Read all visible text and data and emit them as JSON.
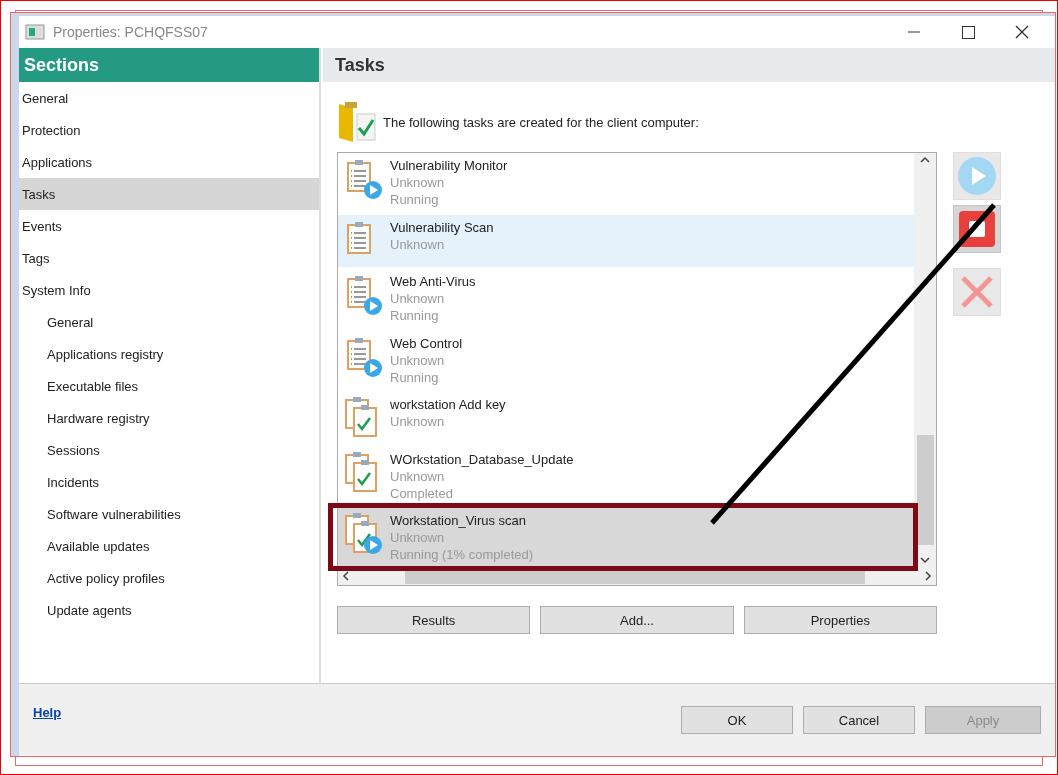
{
  "window": {
    "title": "Properties: PCHQFSS07"
  },
  "sidebar": {
    "title": "Sections",
    "items": [
      {
        "label": "General",
        "selected": false
      },
      {
        "label": "Protection",
        "selected": false
      },
      {
        "label": "Applications",
        "selected": false
      },
      {
        "label": "Tasks",
        "selected": true
      },
      {
        "label": "Events",
        "selected": false
      },
      {
        "label": "Tags",
        "selected": false
      },
      {
        "label": "System Info",
        "selected": false,
        "children": [
          {
            "label": "General",
            "selected": false
          },
          {
            "label": "Applications registry",
            "selected": false
          },
          {
            "label": "Executable files",
            "selected": false
          },
          {
            "label": "Hardware registry",
            "selected": false
          },
          {
            "label": "Sessions",
            "selected": false
          },
          {
            "label": "Incidents",
            "selected": false
          },
          {
            "label": "Software vulnerabilities",
            "selected": false
          },
          {
            "label": "Available updates",
            "selected": false
          },
          {
            "label": "Active policy profiles",
            "selected": false
          },
          {
            "label": "Update agents",
            "selected": false
          }
        ]
      }
    ]
  },
  "pane": {
    "title": "Tasks",
    "intro": "The following tasks are created for the client computer:"
  },
  "tasks": [
    {
      "name": "Vulnerability Monitor",
      "kind": "list",
      "running": true,
      "selected": false,
      "hovered": false,
      "lines": [
        "Unknown",
        "Running"
      ]
    },
    {
      "name": "Vulnerability Scan",
      "kind": "list",
      "running": false,
      "selected": false,
      "hovered": true,
      "lines": [
        "Unknown"
      ]
    },
    {
      "name": "Web Anti-Virus",
      "kind": "list",
      "running": true,
      "selected": false,
      "hovered": false,
      "lines": [
        "Unknown",
        "Running"
      ]
    },
    {
      "name": "Web Control",
      "kind": "list",
      "running": true,
      "selected": false,
      "hovered": false,
      "lines": [
        "Unknown",
        "Running"
      ]
    },
    {
      "name": "workstation Add key",
      "kind": "check",
      "running": false,
      "selected": false,
      "hovered": false,
      "lines": [
        "Unknown"
      ]
    },
    {
      "name": "WOrkstation_Database_Update",
      "kind": "check",
      "running": false,
      "selected": false,
      "hovered": false,
      "lines": [
        "Unknown",
        "Completed"
      ]
    },
    {
      "name": "Workstation_Virus scan",
      "kind": "check",
      "running": true,
      "selected": true,
      "hovered": false,
      "lines": [
        "Unknown",
        "Running (1% completed)"
      ]
    }
  ],
  "side_buttons": [
    {
      "kind": "start",
      "disabled": true
    },
    {
      "kind": "stop",
      "disabled": false
    },
    {
      "kind": "delete",
      "disabled": true
    }
  ],
  "list_buttons": [
    "Results",
    "Add...",
    "Properties"
  ],
  "footer": {
    "help": "Help",
    "buttons": [
      {
        "label": "OK",
        "disabled": false
      },
      {
        "label": "Cancel",
        "disabled": false
      },
      {
        "label": "Apply",
        "disabled": true
      }
    ]
  }
}
